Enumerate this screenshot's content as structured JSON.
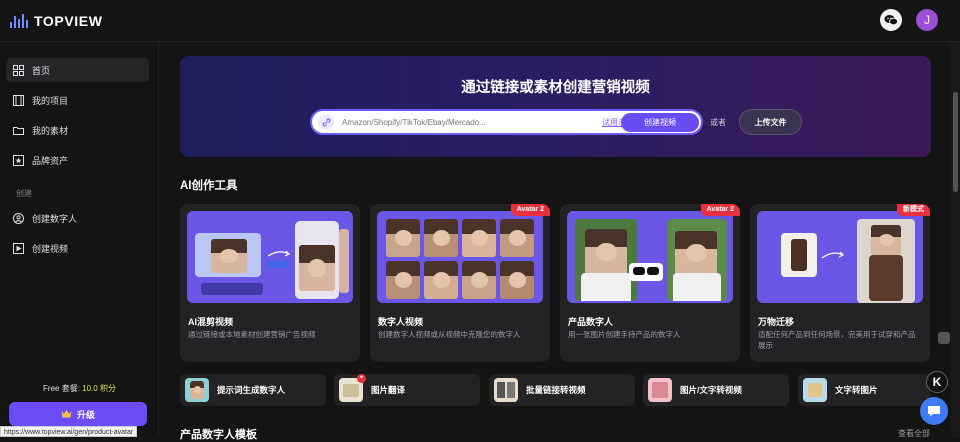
{
  "brand": {
    "name": "TOPVIEW",
    "accent": "#6c4cf5"
  },
  "header": {
    "avatar_letter": "J",
    "wechat_icon": "wechat-icon"
  },
  "sidebar": {
    "items": [
      {
        "label": "首页",
        "icon": "grid-icon"
      },
      {
        "label": "我的项目",
        "icon": "film-icon"
      },
      {
        "label": "我的素材",
        "icon": "folder-icon"
      },
      {
        "label": "品牌资产",
        "icon": "star-box-icon"
      }
    ],
    "section_create": "创建",
    "create_items": [
      {
        "label": "创建数字人",
        "icon": "avatar-add-icon"
      },
      {
        "label": "创建视频",
        "icon": "video-add-icon"
      }
    ],
    "plan_label": "Free 套餐: ",
    "plan_credits": "10.0 积分",
    "upgrade_label": "升级"
  },
  "hero": {
    "title": "通过链接或素材创建营销视频",
    "placeholder": "Amazon/Shopify/TikTok/Ebay/Mercado...",
    "try_example": "试用示例",
    "create_button": "创建视频",
    "or_text": "或者",
    "upload_button": "上传文件"
  },
  "tools_section": {
    "title": "AI创作工具",
    "cards": [
      {
        "title": "AI混剪视频",
        "desc": "通过链接或本地素材创建营销广告视频",
        "badge": ""
      },
      {
        "title": "数字人视频",
        "desc": "创建数字人视频或从视频中克隆您的数字人",
        "badge": "Avatar 2"
      },
      {
        "title": "产品数字人",
        "desc": "用一张图片创建手持产品的数字人",
        "badge": "Avatar 2"
      },
      {
        "title": "万物迁移",
        "desc": "适配任何产品到任何场景，完美用于试穿和产品展示",
        "badge": "新模式"
      }
    ],
    "quick_tools": [
      {
        "label": "提示词生成数字人"
      },
      {
        "label": "图片翻译"
      },
      {
        "label": "批量链接转视频"
      },
      {
        "label": "图片/文字转视频"
      },
      {
        "label": "文字转图片"
      }
    ]
  },
  "bottom": {
    "title": "产品数字人模板",
    "view_all": "查看全部"
  },
  "status_url": "https://www.topview.ai/gen/product-avatar"
}
